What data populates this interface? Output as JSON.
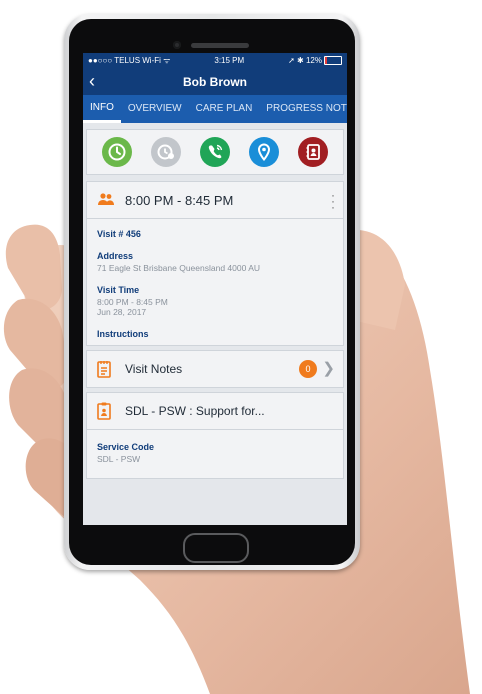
{
  "status": {
    "carrier": "●●○○○ TELUS Wi-Fi ᯤ",
    "time": "3:15 PM",
    "right": "➚ ✱ 12%"
  },
  "nav": {
    "back_glyph": "‹",
    "title": "Bob Brown"
  },
  "tabs": [
    {
      "label": "INFO"
    },
    {
      "label": "OVERVIEW"
    },
    {
      "label": "CARE PLAN"
    },
    {
      "label": "PROGRESS NOT"
    }
  ],
  "actions": [
    {
      "icon": "clock-icon",
      "color": "#6bb84a"
    },
    {
      "icon": "clock-history-icon",
      "color": "#c2c6cb"
    },
    {
      "icon": "phone-icon",
      "color": "#20a557"
    },
    {
      "icon": "location-pin-icon",
      "color": "#1a8ed8"
    },
    {
      "icon": "contact-card-icon",
      "color": "#a11e22"
    }
  ],
  "visit": {
    "time_range": "8:00 PM - 8:45 PM",
    "number": "Visit # 456",
    "address_label": "Address",
    "address": "71 Eagle St Brisbane Queensland 4000 AU",
    "visit_time_label": "Visit Time",
    "visit_time": "8:00 PM - 8:45 PM",
    "visit_date": "Jun 28, 2017",
    "instructions_label": "Instructions"
  },
  "notes": {
    "label": "Visit Notes",
    "count": "0"
  },
  "service": {
    "title": "SDL - PSW : Support for...",
    "code_label": "Service Code",
    "code": "SDL - PSW"
  },
  "colors": {
    "nav": "#113d7a",
    "tabs": "#1c5dae",
    "accent": "#f07b1d"
  }
}
